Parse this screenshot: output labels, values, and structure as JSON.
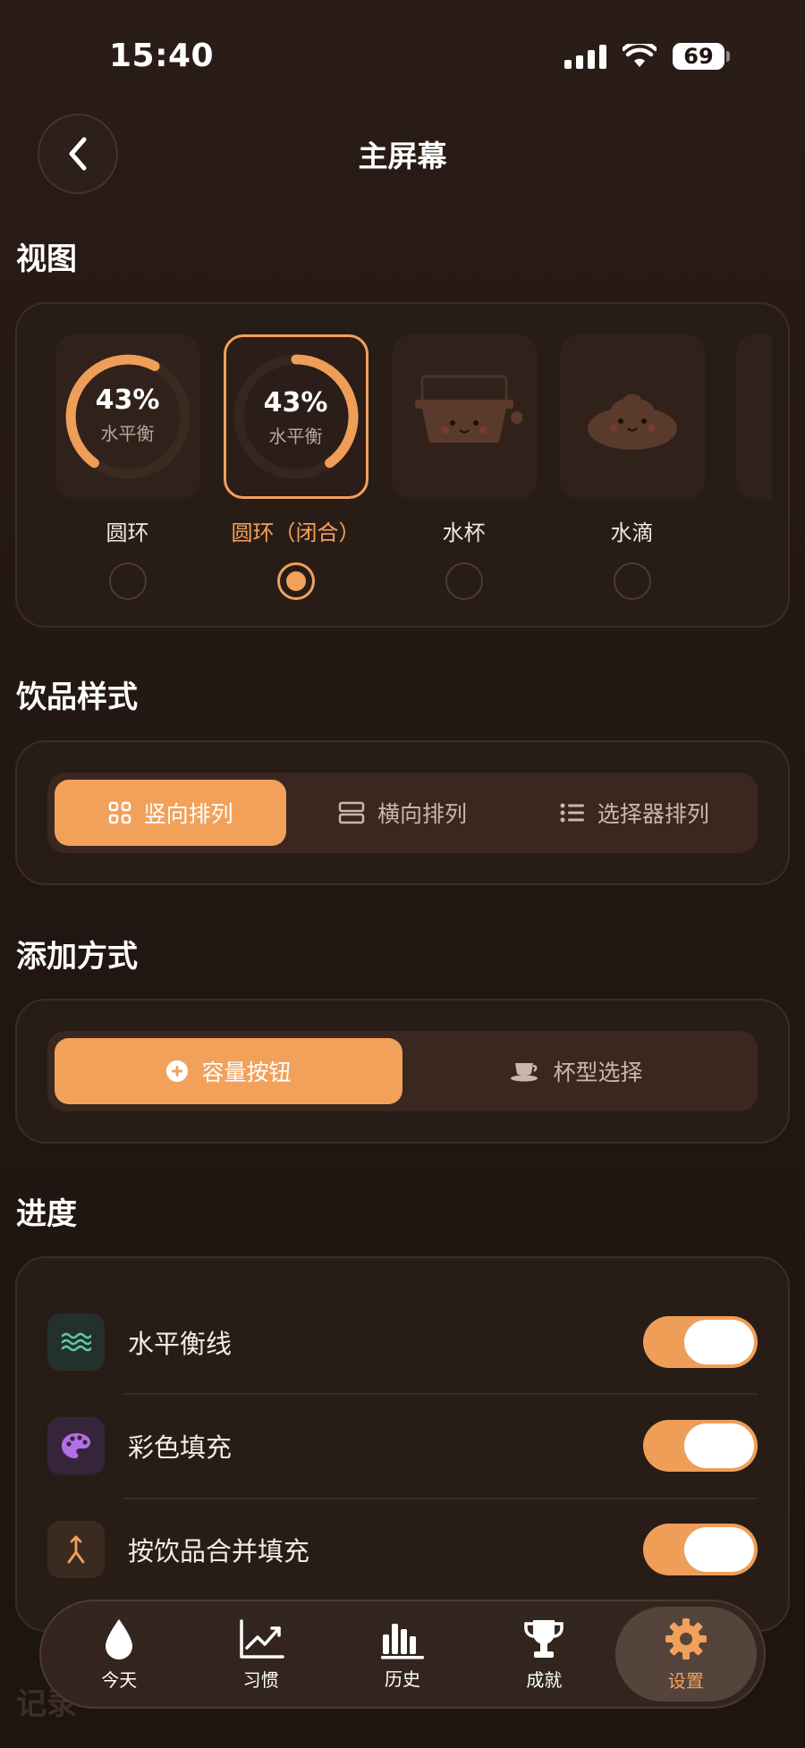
{
  "status_bar": {
    "time": "15:40",
    "battery": "69"
  },
  "header": {
    "title": "主屏幕"
  },
  "sections": {
    "view": {
      "title": "视图",
      "items": [
        {
          "label": "圆环",
          "pct": "43%",
          "sub": "水平衡",
          "selected": false
        },
        {
          "label": "圆环（闭合）",
          "pct": "43%",
          "sub": "水平衡",
          "selected": true
        },
        {
          "label": "水杯",
          "selected": false
        },
        {
          "label": "水滴",
          "selected": false
        }
      ]
    },
    "drink_style": {
      "title": "饮品样式",
      "options": [
        "竖向排列",
        "横向排列",
        "选择器排列"
      ],
      "selected_index": 0
    },
    "add_method": {
      "title": "添加方式",
      "options": [
        "容量按钮",
        "杯型选择"
      ],
      "selected_index": 0
    },
    "progress": {
      "title": "进度",
      "rows": [
        {
          "label": "水平衡线",
          "icon": "waves-icon",
          "enabled": true
        },
        {
          "label": "彩色填充",
          "icon": "palette-icon",
          "enabled": true
        },
        {
          "label": "按饮品合并填充",
          "icon": "merge-icon",
          "enabled": true
        }
      ]
    },
    "records": {
      "title": "记录"
    }
  },
  "tabbar": {
    "items": [
      {
        "label": "今天",
        "icon": "drop-icon"
      },
      {
        "label": "习惯",
        "icon": "trend-chart-icon"
      },
      {
        "label": "历史",
        "icon": "bar-chart-icon"
      },
      {
        "label": "成就",
        "icon": "trophy-icon"
      },
      {
        "label": "设置",
        "icon": "gear-icon"
      }
    ],
    "active_index": 4
  },
  "colors": {
    "accent": "#f2a15b",
    "background": "#241813",
    "card": "#281c17"
  }
}
